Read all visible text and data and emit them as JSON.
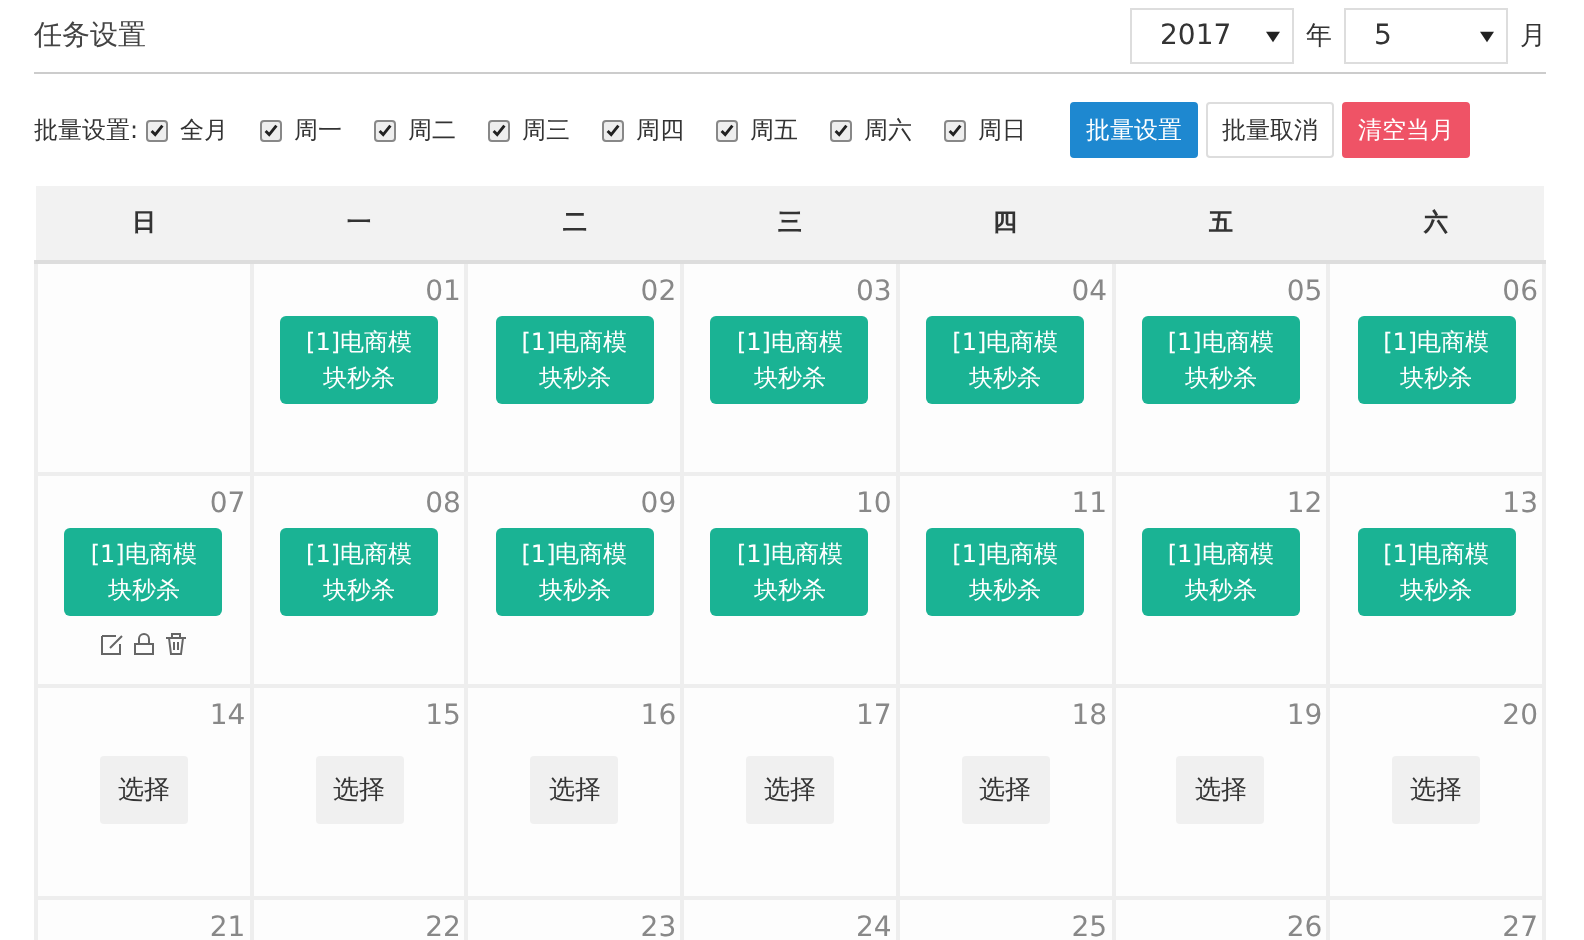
{
  "title": "任务设置",
  "year": {
    "value": "2017",
    "unit": "年"
  },
  "month": {
    "value": "5",
    "unit": "月"
  },
  "batch": {
    "label": "批量设置:",
    "options": [
      {
        "label": "全月",
        "checked": true
      },
      {
        "label": "周一",
        "checked": true
      },
      {
        "label": "周二",
        "checked": true
      },
      {
        "label": "周三",
        "checked": true
      },
      {
        "label": "周四",
        "checked": true
      },
      {
        "label": "周五",
        "checked": true
      },
      {
        "label": "周六",
        "checked": true
      },
      {
        "label": "周日",
        "checked": true
      }
    ]
  },
  "buttons": [
    {
      "label": "批量设置",
      "kind": "primary"
    },
    {
      "label": "批量取消",
      "kind": "default"
    },
    {
      "label": "清空当月",
      "kind": "danger"
    }
  ],
  "weekdays": [
    "日",
    "一",
    "二",
    "三",
    "四",
    "五",
    "六"
  ],
  "weeks": [
    [
      {
        "kind": "empty"
      },
      {
        "day": "01",
        "kind": "task",
        "task": "[1]电商模块秒杀"
      },
      {
        "day": "02",
        "kind": "task",
        "task": "[1]电商模块秒杀"
      },
      {
        "day": "03",
        "kind": "task",
        "task": "[1]电商模块秒杀"
      },
      {
        "day": "04",
        "kind": "task",
        "task": "[1]电商模块秒杀"
      },
      {
        "day": "05",
        "kind": "task",
        "task": "[1]电商模块秒杀"
      },
      {
        "day": "06",
        "kind": "task",
        "task": "[1]电商模块秒杀"
      }
    ],
    [
      {
        "day": "07",
        "kind": "task",
        "task": "[1]电商模块秒杀",
        "actions": true
      },
      {
        "day": "08",
        "kind": "task",
        "task": "[1]电商模块秒杀"
      },
      {
        "day": "09",
        "kind": "task",
        "task": "[1]电商模块秒杀"
      },
      {
        "day": "10",
        "kind": "task",
        "task": "[1]电商模块秒杀"
      },
      {
        "day": "11",
        "kind": "task",
        "task": "[1]电商模块秒杀"
      },
      {
        "day": "12",
        "kind": "task",
        "task": "[1]电商模块秒杀"
      },
      {
        "day": "13",
        "kind": "task",
        "task": "[1]电商模块秒杀"
      }
    ],
    [
      {
        "day": "14",
        "kind": "select",
        "button": "选择"
      },
      {
        "day": "15",
        "kind": "select",
        "button": "选择"
      },
      {
        "day": "16",
        "kind": "select",
        "button": "选择"
      },
      {
        "day": "17",
        "kind": "select",
        "button": "选择"
      },
      {
        "day": "18",
        "kind": "select",
        "button": "选择"
      },
      {
        "day": "19",
        "kind": "select",
        "button": "选择"
      },
      {
        "day": "20",
        "kind": "select",
        "button": "选择"
      }
    ],
    [
      {
        "day": "21",
        "kind": "cut"
      },
      {
        "day": "22",
        "kind": "cut"
      },
      {
        "day": "23",
        "kind": "cut"
      },
      {
        "day": "24",
        "kind": "cut"
      },
      {
        "day": "25",
        "kind": "cut"
      },
      {
        "day": "26",
        "kind": "cut"
      },
      {
        "day": "27",
        "kind": "cut"
      }
    ]
  ]
}
